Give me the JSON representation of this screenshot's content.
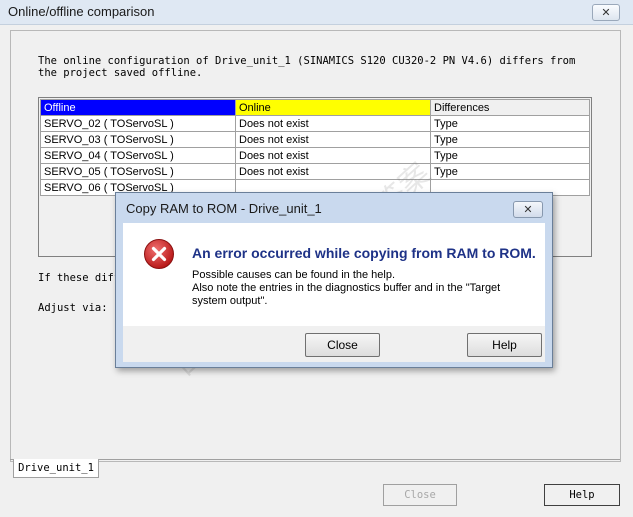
{
  "window": {
    "title": "Online/offline comparison",
    "close_glyph": "✕"
  },
  "description": "The online configuration of Drive_unit_1 (SINAMICS S120 CU320-2 PN V4.6) differs from the project saved offline.",
  "table": {
    "headers": [
      "Offline",
      "Online",
      "Differences"
    ],
    "header_colors": [
      "#0000ff",
      "#ffff00",
      "#f0f0f0"
    ],
    "rows": [
      [
        "SERVO_02 ( TOServoSL )",
        "Does not exist",
        "Type"
      ],
      [
        "SERVO_03 ( TOServoSL )",
        "Does not exist",
        "Type"
      ],
      [
        "SERVO_04 ( TOServoSL )",
        "Does not exist",
        "Type"
      ],
      [
        "SERVO_05 ( TOServoSL )",
        "Does not exist",
        "Type"
      ],
      [
        "SERVO_06 ( TOServoSL )",
        "",
        ""
      ]
    ]
  },
  "if_text": "If these diff",
  "adjust_text": "Adjust via:",
  "tab_label": "Drive_unit_1",
  "buttons": {
    "close": "Close",
    "help": "Help"
  },
  "watermark": {
    "line1": "西门子",
    "line2": "support.industry.siemens.com/cs",
    "line3": "找答案"
  },
  "dialog": {
    "title": "Copy RAM to ROM - Drive_unit_1",
    "close_glyph": "✕",
    "icon": "error-icon",
    "headline": "An error occurred while copying from RAM to ROM.",
    "line1": "Possible causes can be found in the help.",
    "line2": "Also note the entries in the diagnostics buffer and in the \"Target system output\".",
    "close_label": "Close",
    "help_label": "Help"
  }
}
